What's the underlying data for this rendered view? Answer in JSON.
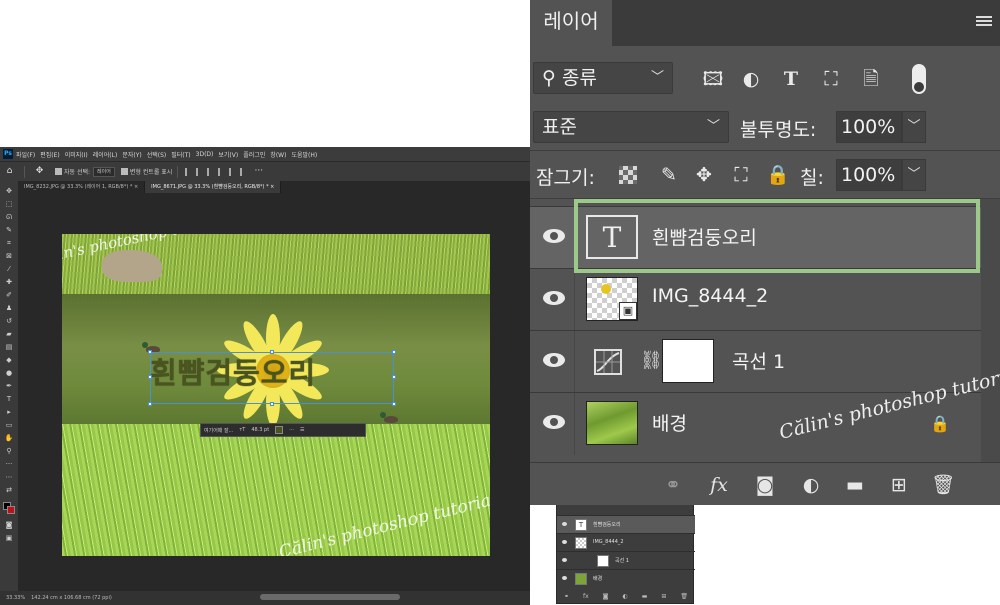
{
  "photoshop": {
    "logo": "Ps",
    "menu": [
      "파일(F)",
      "편집(E)",
      "이미지(I)",
      "레이어(L)",
      "문자(Y)",
      "선택(S)",
      "필터(T)",
      "3D(D)",
      "보기(V)",
      "플러그인",
      "창(W)",
      "도움말(H)"
    ],
    "options": {
      "auto_select": "자동 선택:",
      "auto_select_value": "레이어",
      "transform_controls": "변형 컨트롤 표시"
    },
    "tabs": [
      "IMG_8232.JPG @ 33.3% (레이어 1, RGB/8*) *",
      "IMG_8671.JPG @ 33.3% (흰뺨검둥오리, RGB/8*) *"
    ],
    "status": {
      "zoom": "33.33%",
      "doc_size": "142.24 cm x 106.68 cm (72 ppi)"
    },
    "canvas_text": "흰뺨검둥오리",
    "context_bar": {
      "font": "여기어때 잘...",
      "size": "48.3 pt"
    },
    "watermark": "Călin's photoshop tutorial"
  },
  "mini_layers": {
    "rows": [
      {
        "label": "흰뺨검둥오리",
        "selected": true
      },
      {
        "label": "IMG_8444_2",
        "selected": false
      },
      {
        "label": "곡선 1",
        "selected": false
      },
      {
        "label": "배경",
        "selected": false
      }
    ]
  },
  "layers_panel": {
    "tab_label": "레이어",
    "filter_kind": "종류",
    "blend_mode": "표준",
    "opacity_label": "불투명도:",
    "opacity_value": "100%",
    "lock_label": "잠그기:",
    "fill_label": "칠:",
    "fill_value": "100%",
    "layers": [
      {
        "name": "흰뺨검둥오리",
        "type": "text",
        "thumb_glyph": "T",
        "selected": true
      },
      {
        "name": "IMG_8444_2",
        "type": "smart-object",
        "selected": false
      },
      {
        "name": "곡선 1",
        "type": "adjustment-curves",
        "selected": false
      },
      {
        "name": "배경",
        "type": "background",
        "locked": true,
        "selected": false
      }
    ],
    "highlight_color": "#9cc98a",
    "footer_icons": [
      "link-icon",
      "fx-icon",
      "mask-icon",
      "adjustment-icon",
      "folder-icon",
      "new-layer-icon",
      "trash-icon"
    ]
  }
}
